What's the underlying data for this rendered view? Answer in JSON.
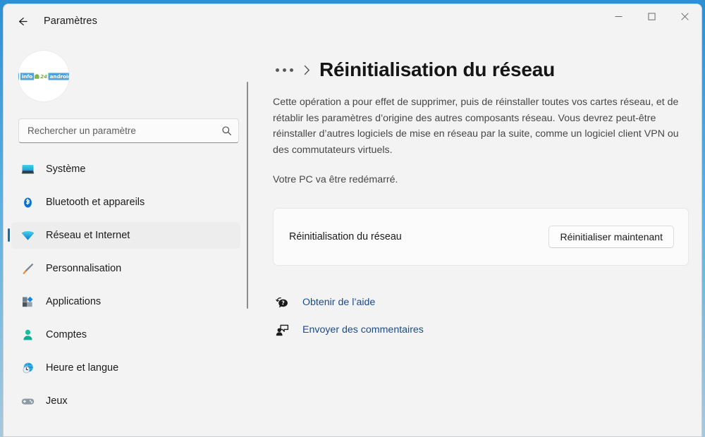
{
  "window": {
    "app_title": "Paramètres",
    "back_icon": "back-arrow-icon",
    "minimize_label": "—",
    "maximize_label": "□",
    "close_label": "✕"
  },
  "sidebar": {
    "avatar": {
      "alt": "info24android",
      "text_info": "info",
      "text_24": "24",
      "text_android": "android"
    },
    "search": {
      "placeholder": "Rechercher un paramètre",
      "value": "",
      "icon": "search-icon"
    },
    "items": [
      {
        "label": "Système",
        "icon": "monitor-icon",
        "selected": false
      },
      {
        "label": "Bluetooth et appareils",
        "icon": "bluetooth-icon",
        "selected": false
      },
      {
        "label": "Réseau et Internet",
        "icon": "wifi-icon",
        "selected": true
      },
      {
        "label": "Personnalisation",
        "icon": "paintbrush-icon",
        "selected": false
      },
      {
        "label": "Applications",
        "icon": "apps-grid-icon",
        "selected": false
      },
      {
        "label": "Comptes",
        "icon": "person-icon",
        "selected": false
      },
      {
        "label": "Heure et langue",
        "icon": "globe-clock-icon",
        "selected": false
      },
      {
        "label": "Jeux",
        "icon": "gamepad-icon",
        "selected": false
      }
    ]
  },
  "main": {
    "breadcrumb": {
      "ellipsis": "…",
      "separator": "›"
    },
    "page_title": "Réinitialisation du réseau",
    "description": "Cette opération a pour effet de supprimer, puis de réinstaller toutes vos cartes réseau, et de rétablir les paramètres d’origine des autres composants réseau. Vous devrez peut-être réinstaller d’autres logiciels de mise en réseau par la suite, comme un logiciel client VPN ou des commutateurs virtuels.",
    "restart_note": "Votre PC va être redémarré.",
    "card": {
      "label": "Réinitialisation du réseau",
      "button_label": "Réinitialiser maintenant"
    },
    "footer_links": [
      {
        "label": "Obtenir de l’aide",
        "icon": "help-question-icon"
      },
      {
        "label": "Envoyer des commentaires",
        "icon": "feedback-person-icon"
      }
    ]
  },
  "colors": {
    "accent": "#0f6cbd",
    "link": "#1a4b8c",
    "desktop": "#2d8fd4",
    "window_bg": "#f3f3f3"
  }
}
